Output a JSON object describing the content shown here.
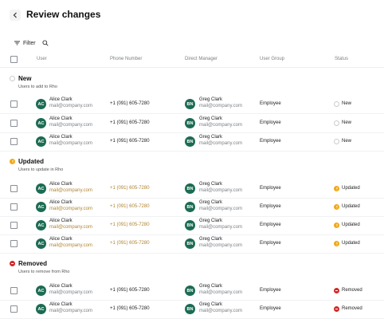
{
  "header": {
    "title": "Review changes"
  },
  "toolbar": {
    "filter_label": "Filter"
  },
  "columns": {
    "user": "User",
    "phone": "Phone Number",
    "manager": "Direct Manager",
    "group": "User Group",
    "status": "Status"
  },
  "sections": [
    {
      "title": "New",
      "subtitle": "Users to add to Rho",
      "rows": [
        {
          "initials": "AC",
          "name": "Alice Clark",
          "email": "mail@company.com",
          "phone": "+1 (091) 605-7280",
          "mgr_initials": "BN",
          "mgr_name": "Greg Clark",
          "mgr_email": "mail@company.com",
          "group": "Employee",
          "status": "New"
        },
        {
          "initials": "AC",
          "name": "Alice Clark",
          "email": "mail@company.com",
          "phone": "+1 (091) 605-7280",
          "mgr_initials": "BN",
          "mgr_name": "Greg Clark",
          "mgr_email": "mail@company.com",
          "group": "Employee",
          "status": "New"
        },
        {
          "initials": "AC",
          "name": "Alice Clark",
          "email": "mail@company.com",
          "phone": "+1 (091) 605-7280",
          "mgr_initials": "BN",
          "mgr_name": "Greg Clark",
          "mgr_email": "mail@company.com",
          "group": "Employee",
          "status": "New"
        }
      ]
    },
    {
      "title": "Updated",
      "subtitle": "Users to update in Rho",
      "rows": [
        {
          "initials": "AC",
          "name": "Alice Clark",
          "email": "mail@company.com",
          "phone": "+1 (091) 605-7280",
          "mgr_initials": "BN",
          "mgr_name": "Greg Clark",
          "mgr_email": "mail@company.com",
          "group": "Employee",
          "status": "Updated"
        },
        {
          "initials": "AC",
          "name": "Alice Clark",
          "email": "mail@company.com",
          "phone": "+1 (091) 605-7280",
          "mgr_initials": "BN",
          "mgr_name": "Greg Clark",
          "mgr_email": "mail@company.com",
          "group": "Employee",
          "status": "Updated"
        },
        {
          "initials": "AC",
          "name": "Alice Clark",
          "email": "mail@company.com",
          "phone": "+1 (091) 605-7280",
          "mgr_initials": "BN",
          "mgr_name": "Greg Clark",
          "mgr_email": "mail@company.com",
          "group": "Employee",
          "status": "Updated"
        },
        {
          "initials": "AC",
          "name": "Alice Clark",
          "email": "mail@company.com",
          "phone": "+1 (091) 605-7280",
          "mgr_initials": "BN",
          "mgr_name": "Greg Clark",
          "mgr_email": "mail@company.com",
          "group": "Employee",
          "status": "Updated"
        }
      ]
    },
    {
      "title": "Removed",
      "subtitle": "Users to remove from Rho",
      "rows": [
        {
          "initials": "AC",
          "name": "Alice Clark",
          "email": "mail@company.com",
          "phone": "+1 (091) 605-7280",
          "mgr_initials": "BN",
          "mgr_name": "Greg Clark",
          "mgr_email": "mail@company.com",
          "group": "Employee",
          "status": "Removed"
        },
        {
          "initials": "AC",
          "name": "Alice Clark",
          "email": "mail@company.com",
          "phone": "+1 (091) 605-7280",
          "mgr_initials": "BN",
          "mgr_name": "Greg Clark",
          "mgr_email": "mail@company.com",
          "group": "Employee",
          "status": "Removed"
        }
      ]
    }
  ],
  "colors": {
    "avatar": "#1c6b53",
    "updated": "#f0a818",
    "removed": "#d12a2a",
    "updated_text": "#b08532"
  }
}
